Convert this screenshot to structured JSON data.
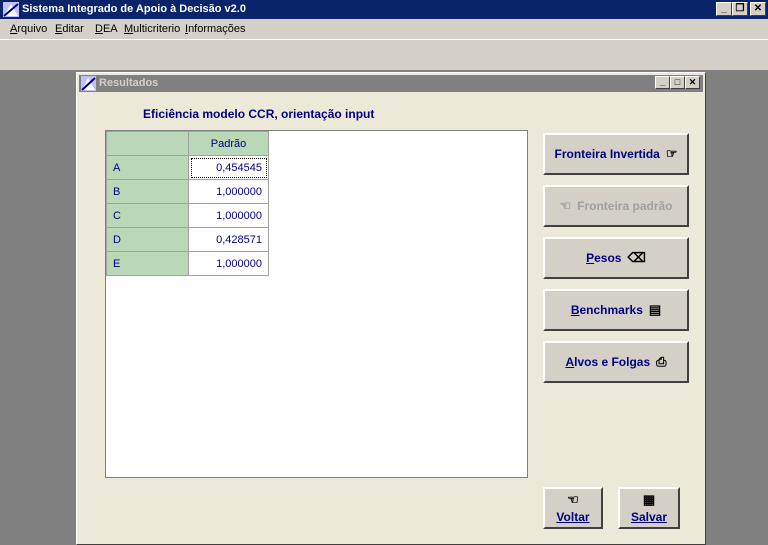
{
  "app": {
    "title": "Sistema Integrado de Apoio à Decisão v2.0"
  },
  "menu": [
    "Arquivo",
    "Editar",
    "DEA",
    "Multicriterio",
    "Informações"
  ],
  "window": {
    "title": "Resultados"
  },
  "heading": "Eficiência modelo CCR, orientação input",
  "table": {
    "column_header": "Padrão",
    "rows": [
      {
        "label": "A",
        "value": "0,454545"
      },
      {
        "label": "B",
        "value": "1,000000"
      },
      {
        "label": "C",
        "value": "1,000000"
      },
      {
        "label": "D",
        "value": "0,428571"
      },
      {
        "label": "E",
        "value": "1,000000"
      }
    ]
  },
  "buttons": {
    "fronteira_invertida": "Fronteira Invertida",
    "fronteira_padrao": "Fronteira padrão",
    "pesos": "Pesos",
    "benchmarks": "Benchmarks",
    "alvos_folgas": "Alvos e Folgas",
    "voltar": "Voltar",
    "salvar": "Salvar"
  },
  "icons": {
    "pointing-right-hand": "☞",
    "pointing-left-hand": "☜",
    "eraser": "⌫",
    "document": "▤",
    "printer": "⎙",
    "save": "▦"
  }
}
